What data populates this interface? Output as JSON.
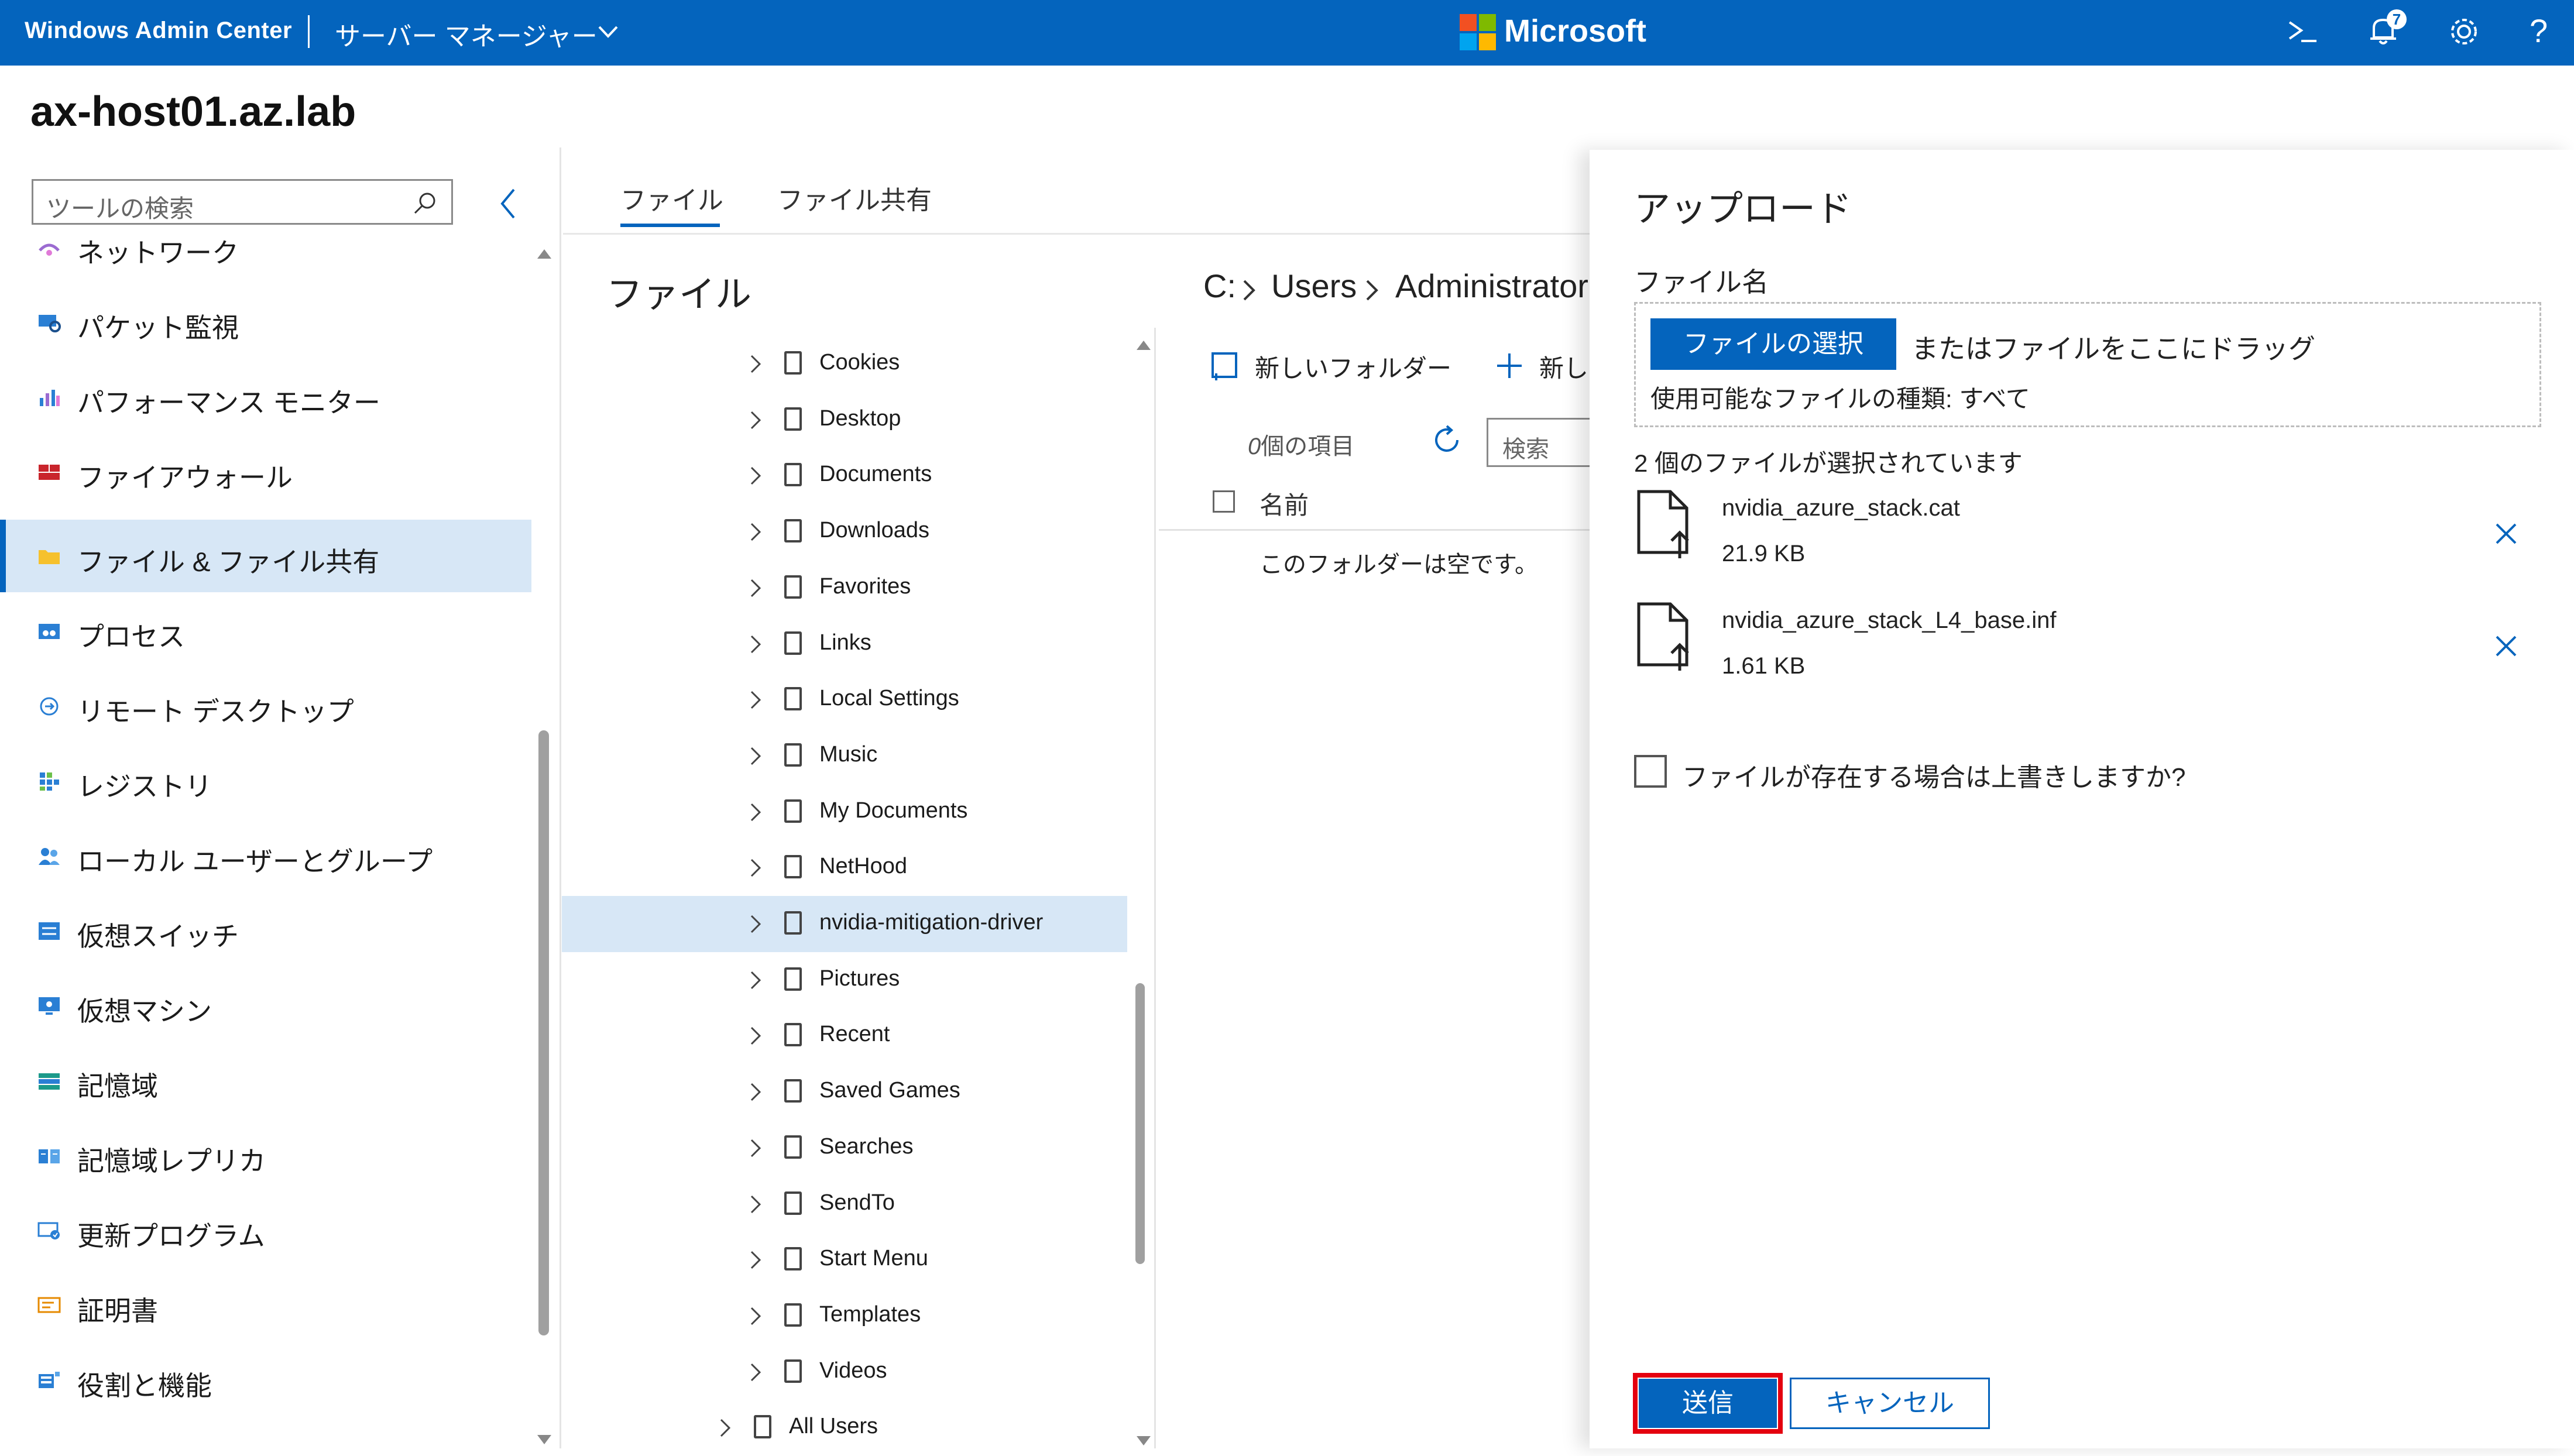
{
  "topbar": {
    "app_name": "Windows Admin Center",
    "connection_type": "サーバー マネージャー",
    "brand": "Microsoft",
    "notification_count": "7",
    "help_glyph": "?",
    "icons": [
      "terminal-icon",
      "notification-bell-icon",
      "settings-gear-icon",
      "help-icon"
    ]
  },
  "server": {
    "name": "ax-host01.az.lab"
  },
  "tools": {
    "search_placeholder": "ツールの検索",
    "items": [
      {
        "label": "ネットワーク",
        "icon": "network-icon"
      },
      {
        "label": "パケット監視",
        "icon": "packet-monitoring-icon"
      },
      {
        "label": "パフォーマンス モニター",
        "icon": "performance-monitor-icon"
      },
      {
        "label": "ファイアウォール",
        "icon": "firewall-icon"
      },
      {
        "label": "ファイル & ファイル共有",
        "icon": "folder-icon",
        "selected": true
      },
      {
        "label": "プロセス",
        "icon": "processes-icon"
      },
      {
        "label": "リモート デスクトップ",
        "icon": "remote-desktop-icon"
      },
      {
        "label": "レジストリ",
        "icon": "registry-icon"
      },
      {
        "label": "ローカル ユーザーとグループ",
        "icon": "users-groups-icon"
      },
      {
        "label": "仮想スイッチ",
        "icon": "virtual-switch-icon"
      },
      {
        "label": "仮想マシン",
        "icon": "virtual-machine-icon"
      },
      {
        "label": "記憶域",
        "icon": "storage-icon"
      },
      {
        "label": "記憶域レプリカ",
        "icon": "storage-replica-icon"
      },
      {
        "label": "更新プログラム",
        "icon": "updates-icon"
      },
      {
        "label": "証明書",
        "icon": "certificate-icon"
      },
      {
        "label": "役割と機能",
        "icon": "roles-features-icon"
      }
    ]
  },
  "files": {
    "tabs": [
      "ファイル",
      "ファイル共有"
    ],
    "active_tab": 0,
    "heading": "ファイル",
    "tree": [
      {
        "label": "Cookies"
      },
      {
        "label": "Desktop"
      },
      {
        "label": "Documents"
      },
      {
        "label": "Downloads"
      },
      {
        "label": "Favorites"
      },
      {
        "label": "Links"
      },
      {
        "label": "Local Settings"
      },
      {
        "label": "Music"
      },
      {
        "label": "My Documents"
      },
      {
        "label": "NetHood"
      },
      {
        "label": "nvidia-mitigation-driver",
        "selected": true
      },
      {
        "label": "Pictures"
      },
      {
        "label": "Recent"
      },
      {
        "label": "Saved Games"
      },
      {
        "label": "Searches"
      },
      {
        "label": "SendTo"
      },
      {
        "label": "Start Menu"
      },
      {
        "label": "Templates"
      },
      {
        "label": "Videos"
      },
      {
        "label": "All Users",
        "level": 0
      }
    ],
    "path": [
      "C:",
      "Users",
      "Administrator"
    ],
    "new_folder_label": "新しいフォルダー",
    "new_file_label": "新し",
    "items_count_num": "0",
    "items_count_suffix": "個の項目",
    "search_placeholder": "検索",
    "column_name": "名前",
    "empty_message": "このフォルダーは空です。"
  },
  "upload": {
    "title": "アップロード",
    "file_name_label": "ファイル名",
    "choose_button": "ファイルの選択",
    "drag_text": "またはファイルをここにドラッグ",
    "allowed_types": "使用可能なファイルの種類: すべて",
    "selected_count_text": "2 個のファイルが選択されています",
    "files": [
      {
        "name": "nvidia_azure_stack.cat",
        "size": "21.9 KB"
      },
      {
        "name": "nvidia_azure_stack_L4_base.inf",
        "size": "1.61 KB"
      }
    ],
    "overwrite_label": "ファイルが存在する場合は上書きしますか?",
    "overwrite_checked": false,
    "submit_label": "送信",
    "cancel_label": "キャンセル"
  },
  "colors": {
    "brand_blue": "#0464bd",
    "selection": "#d7e7f6",
    "highlight_red": "#e4000f"
  }
}
